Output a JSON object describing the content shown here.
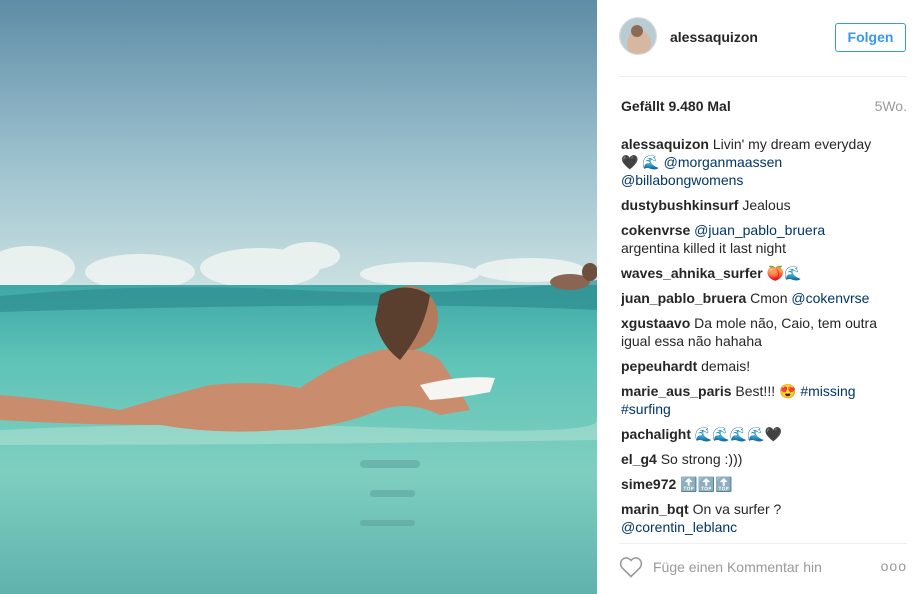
{
  "post": {
    "username": "alessaquizon",
    "follow_label": "Folgen",
    "likes": "Gefällt 9.480 Mal",
    "age": "5Wo.",
    "caption": {
      "user": "alessaquizon",
      "text": "Livin' my dream everyday",
      "emoji": "🖤 🌊",
      "mention1": "@morganmaassen",
      "mention2": "@billabongwomens"
    },
    "comment_placeholder": "Füge einen Kommentar hin",
    "more_label": "ooo"
  },
  "comments": [
    {
      "user": "dustybushkinsurf",
      "text": "Jealous"
    },
    {
      "user": "cokenvrse",
      "mention": "@juan_pablo_bruera",
      "text": "argentina killed it last night"
    },
    {
      "user": "waves_ahnika_surfer",
      "text": "🍑🌊"
    },
    {
      "user": "juan_pablo_bruera",
      "text": "Cmon",
      "mention": "@cokenvrse"
    },
    {
      "user": "xgustaavo",
      "text": "Da mole não, Caio, tem outra igual essa não hahaha"
    },
    {
      "user": "pepeuhardt",
      "text": "demais!"
    },
    {
      "user": "marie_aus_paris",
      "text": "Best!!! 😍",
      "tag1": "#missing",
      "tag2": "#surfing"
    },
    {
      "user": "pachalight",
      "text": "🌊🌊🌊🌊🖤"
    },
    {
      "user": "el_g4",
      "text": "So strong :)))"
    },
    {
      "user": "sime972",
      "text": "🔝🔝🔝"
    },
    {
      "user": "marin_bqt",
      "text": "On va surfer ?",
      "mention": "@corentin_leblanc"
    }
  ],
  "colors": {
    "link": "#003569",
    "follow_blue": "#3897f0",
    "muted": "#999999",
    "text": "#262626"
  },
  "icons": {
    "like": "heart-outline-icon",
    "more": "ellipsis-icon"
  }
}
